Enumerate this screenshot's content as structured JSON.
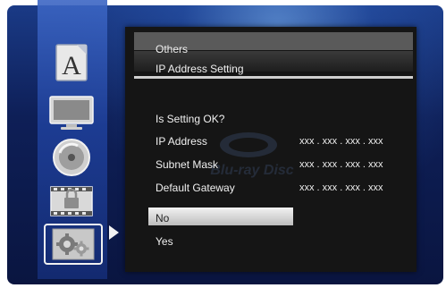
{
  "sidebar": {
    "icons": [
      {
        "name": "font-icon",
        "letter": "A"
      },
      {
        "name": "tv-icon"
      },
      {
        "name": "disc-icon"
      },
      {
        "name": "parental-lock-icon"
      },
      {
        "name": "settings-gear-icon"
      }
    ]
  },
  "panel": {
    "breadcrumb": "Others",
    "title": "IP Address Setting",
    "question": "Is Setting OK?",
    "rows": [
      {
        "label": "IP Address",
        "value": "xxx . xxx . xxx . xxx"
      },
      {
        "label": "Subnet Mask",
        "value": "xxx . xxx . xxx . xxx"
      },
      {
        "label": "Default Gateway",
        "value": "xxx . xxx . xxx . xxx"
      }
    ],
    "options": {
      "no": "No",
      "yes": "Yes"
    },
    "watermark": "Blu-ray Disc"
  },
  "colors": {
    "background": "#0e1f57",
    "sidebar": "#2a4fae",
    "panel": "#151515",
    "highlight": "#d8d8d8"
  }
}
